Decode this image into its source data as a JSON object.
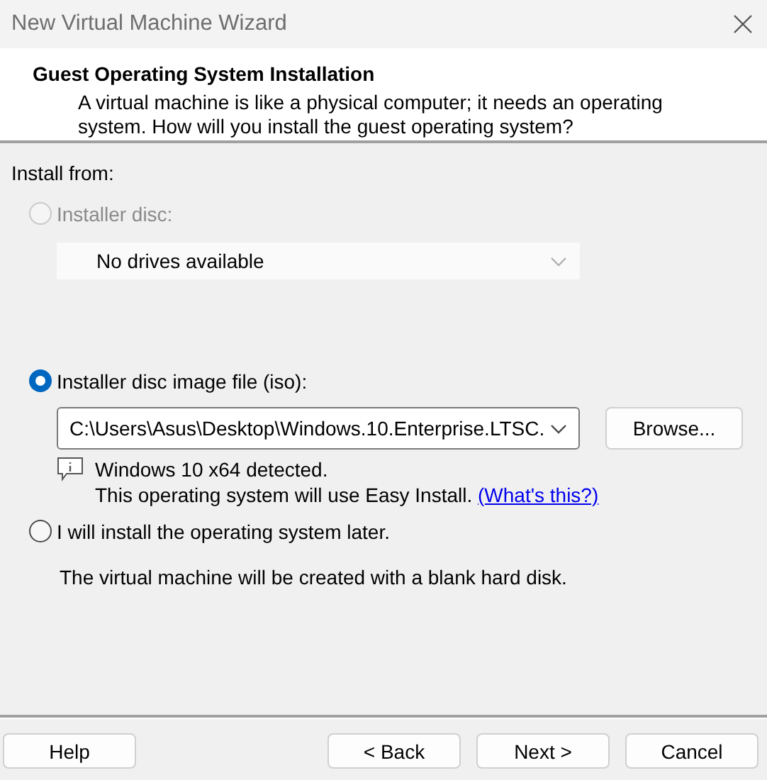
{
  "window": {
    "title": "New Virtual Machine Wizard"
  },
  "header": {
    "title": "Guest Operating System Installation",
    "description": "A virtual machine is like a physical computer; it needs an operating system. How will you install the guest operating system?"
  },
  "install_from_label": "Install from:",
  "options": [
    {
      "kind": "disc",
      "label": "Installer disc:",
      "selected": false,
      "disabled": true,
      "dropdown": {
        "value": "No drives available"
      }
    },
    {
      "kind": "iso",
      "label": "Installer disc image file (iso):",
      "selected": true,
      "disabled": false,
      "dropdown": {
        "value": "C:\\Users\\Asus\\Desktop\\Windows.10.Enterprise.LTSC."
      },
      "browse": "Browse...",
      "info": {
        "detected": "Windows 10 x64 detected.",
        "easy_install": "This operating system will use Easy Install.",
        "link": "(What's this?)"
      }
    },
    {
      "kind": "later",
      "label": "I will install the operating system later.",
      "selected": false,
      "disabled": false,
      "note": "The virtual machine will be created with a blank hard disk."
    }
  ],
  "buttons": {
    "help": "Help",
    "navigation": [
      "< Back",
      "Next >",
      "Cancel"
    ]
  }
}
